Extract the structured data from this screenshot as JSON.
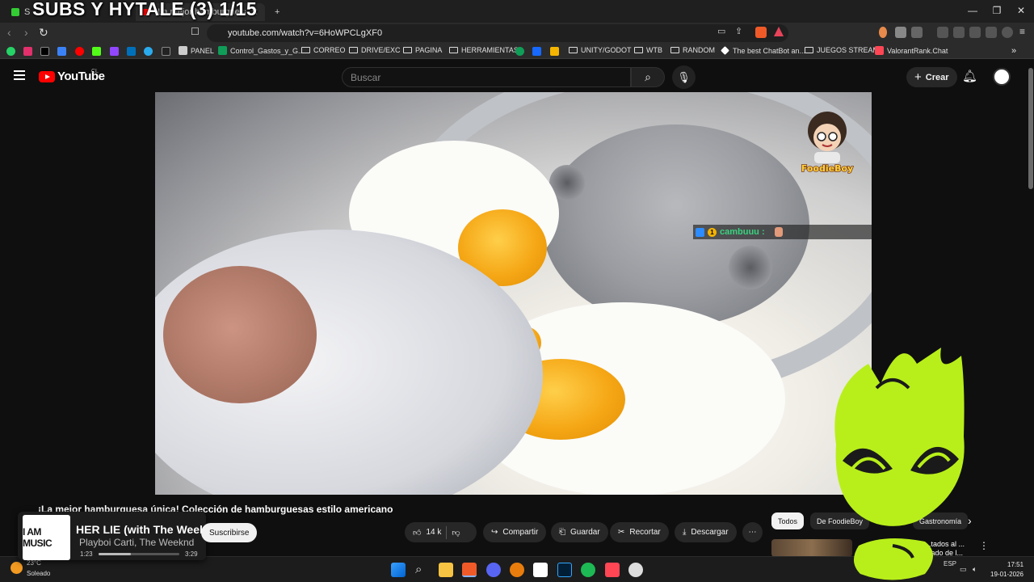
{
  "overlay_title": "SUBS Y HYTALE (3) 1/15",
  "browser": {
    "tabs": [
      {
        "label": "S",
        "active": false
      },
      {
        "label": "¡La mejor hamburguesa única!",
        "active": true
      }
    ],
    "new_tab": "+",
    "url": "youtube.com/watch?v=6HoWPCLgXF0",
    "bookmarks": [
      {
        "label": "PANEL",
        "type": "page"
      },
      {
        "label": "Control_Gastos_y_G...",
        "type": "sheet"
      },
      {
        "label": "CORREO",
        "type": "folder"
      },
      {
        "label": "DRIVE/EXC",
        "type": "folder"
      },
      {
        "label": "PAGINA",
        "type": "folder"
      },
      {
        "label": "HERRAMIENTAS",
        "type": "folder"
      },
      {
        "label": "UNITY/GODOT",
        "type": "folder"
      },
      {
        "label": "WTB",
        "type": "folder"
      },
      {
        "label": "RANDOM",
        "type": "folder"
      },
      {
        "label": "The best ChatBot an...",
        "type": "page"
      },
      {
        "label": "JUEGOS STREAM",
        "type": "folder"
      },
      {
        "label": "ValorantRank.Chat",
        "type": "page"
      }
    ],
    "more_bookmarks": "»"
  },
  "youtube": {
    "logo_text": "YouTube",
    "region": "CL",
    "search_placeholder": "Buscar",
    "create_label": "Crear",
    "video_title": "¡La mejor hamburguesa única! Colección de hamburguesas estilo americano",
    "subscribe_label": "Suscribirse",
    "like_count": "14 k",
    "actions": {
      "share": "Compartir",
      "save": "Guardar",
      "clip": "Recortar",
      "download": "Descargar",
      "more": "⋯"
    },
    "chips": [
      "Todos",
      "De FoodieBoy",
      "Gastronomía"
    ],
    "chip_next": "›",
    "recommendation_title": "...tados al ... ntado de l...",
    "recommendation_more": "⋮"
  },
  "video_overlay": {
    "watermark": "FoodieBoy",
    "chat_badge": "1",
    "chat_user": "cambuuu :",
    "chat_colors": {
      "badge_blue": "#2d8cff",
      "badge_gold": "#f4b400",
      "user": "#3ad27f"
    }
  },
  "now_playing": {
    "cover_text": "I AM MUSIC",
    "song": "HER LIE (with The Weeknd)",
    "artist": "Playboi Carti, The Weeknd",
    "elapsed": "1:23",
    "total": "3:29",
    "progress": 0.4
  },
  "taskbar": {
    "weather_temp": "23°C",
    "weather_text": "Soleado",
    "time": "17:51",
    "date": "19-01-2026",
    "lang": "ESP"
  },
  "colors": {
    "yt_red": "#ff0000",
    "mascot_green": "#b8ef1a",
    "mascot_dark": "#1a1a1a"
  }
}
